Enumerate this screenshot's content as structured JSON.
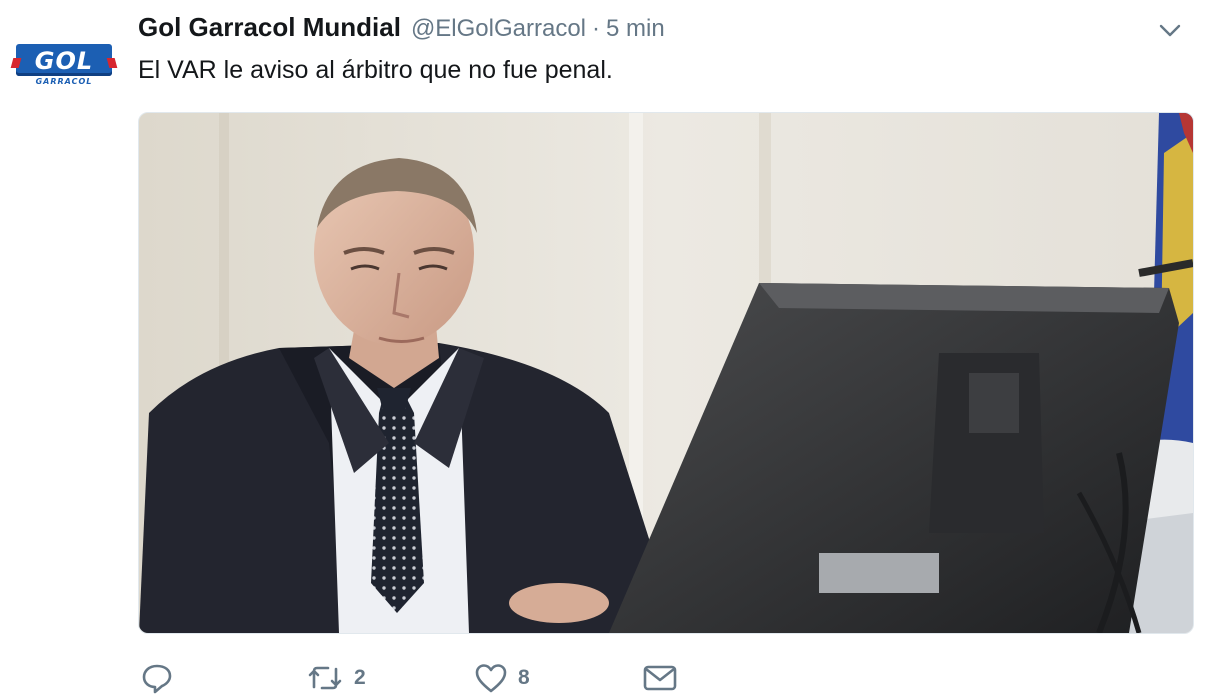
{
  "author": {
    "name": "Gol Garracol Mundial",
    "handle": "@ElGolGarracol",
    "separator": "·",
    "time": "5 min",
    "avatar": {
      "logo_text": "GOL",
      "logo_subtext": "GARRACOL",
      "colors": {
        "blue": "#1c5fb3",
        "red": "#d7262f"
      }
    }
  },
  "tweet": {
    "text": "El VAR le aviso al árbitro que no fue penal.",
    "menu_icon": "chevron-down-icon"
  },
  "media": {
    "kind": "photo"
  },
  "actions": {
    "reply": {
      "icon": "reply-icon",
      "count": ""
    },
    "retweet": {
      "icon": "retweet-icon",
      "count": "2"
    },
    "like": {
      "icon": "heart-icon",
      "count": "8"
    },
    "message": {
      "icon": "envelope-icon",
      "count": ""
    }
  },
  "colors": {
    "text_primary": "#14171a",
    "text_secondary": "#657786",
    "border": "#e1e8ed"
  }
}
